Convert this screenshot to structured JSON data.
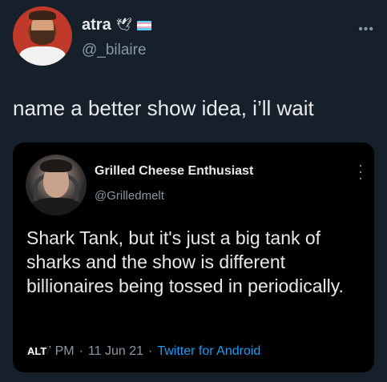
{
  "outer_tweet": {
    "display_name": "atra",
    "handle": "@_bilaire",
    "text": "name a better show idea, i’ll wait",
    "name_emoji": "🕊",
    "flag_colors": [
      "#5bcefa",
      "#f5a9b8",
      "#ffffff",
      "#f5a9b8",
      "#5bcefa"
    ]
  },
  "quoted_tweet": {
    "display_name": "Grilled Cheese Enthusiast",
    "handle": "@Grilledmelt",
    "text": "Shark Tank, but it's just a big tank of sharks and the show is different billionaires being tossed in periodically.",
    "time": "4:47 PM",
    "date": "11 Jun 21",
    "source": "Twitter for Android",
    "separator": "·",
    "alt_badge": "ALT"
  },
  "colors": {
    "background": "#15202b",
    "card_background": "#000000",
    "primary_text": "#e7e9ea",
    "secondary_text": "#8b98a5",
    "link": "#1d9bf0"
  },
  "icons": {
    "outer_more": "more-horizontal-icon",
    "quote_more": "more-vertical-icon"
  }
}
